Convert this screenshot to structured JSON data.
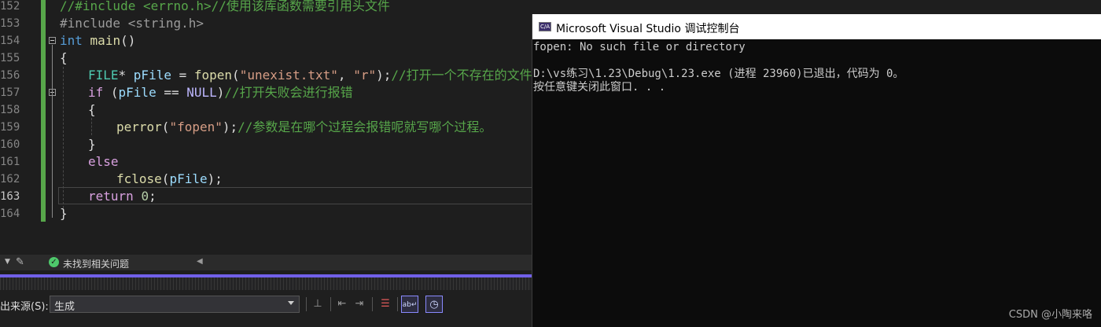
{
  "editor": {
    "lines": [
      {
        "num": "152"
      },
      {
        "num": "153"
      },
      {
        "num": "154"
      },
      {
        "num": "155"
      },
      {
        "num": "156"
      },
      {
        "num": "157"
      },
      {
        "num": "158"
      },
      {
        "num": "159"
      },
      {
        "num": "160"
      },
      {
        "num": "161"
      },
      {
        "num": "162"
      },
      {
        "num": "163"
      },
      {
        "num": "164"
      }
    ],
    "code": {
      "l152": "//#include <errno.h>//使用该库函数需要引用头文件",
      "l153": "#include <string.h>",
      "l154_kw": "int",
      "l154_fn": "main",
      "l154_rest": "()",
      "l155": "{",
      "l156_type": "FILE",
      "l156_a": "* ",
      "l156_var": "pFile",
      "l156_b": " = ",
      "l156_fn": "fopen",
      "l156_c": "(",
      "l156_s1": "\"unexist.txt\"",
      "l156_d": ", ",
      "l156_s2": "\"r\"",
      "l156_e": ");",
      "l156_cm": "//打开一个不存在的文件",
      "l157_kw": "if",
      "l157_a": " (",
      "l157_var": "pFile",
      "l157_b": " == ",
      "l157_mac": "NULL",
      "l157_c": ")",
      "l157_cm": "//打开失败会进行报错",
      "l158": "{",
      "l159_fn": "perror",
      "l159_a": "(",
      "l159_s": "\"fopen\"",
      "l159_b": ");",
      "l159_cm": "//参数是在哪个过程会报错呢就写哪个过程。",
      "l160": "}",
      "l161_kw": "else",
      "l162_fn": "fclose",
      "l162_a": "(",
      "l162_var": "pFile",
      "l162_b": ");",
      "l163_kw": "return",
      "l163_num": "0",
      "l163_b": ";",
      "l164": "}"
    }
  },
  "status_bar": {
    "message": "未找到相关问题",
    "ok_glyph": "✓"
  },
  "output_panel": {
    "source_label": "出来源(S):",
    "source_value": "生成"
  },
  "console": {
    "title": "Microsoft Visual Studio 调试控制台",
    "icon_text": "C/A",
    "output": "fopen: No such file or directory\n\nD:\\vs练习\\1.23\\Debug\\1.23.exe (进程 23960)已退出，代码为 0。\n按任意键关闭此窗口. . .",
    "watermark": "CSDN @小陶来咯"
  },
  "colors": {
    "editor_bg": "#1e1e1e",
    "keyword": "#569cd6",
    "function": "#dcdcaa",
    "type": "#4ec9b0",
    "string": "#d69d85",
    "comment": "#57a64a",
    "accent": "#7160e8",
    "console_bg": "#0c0c0c"
  }
}
